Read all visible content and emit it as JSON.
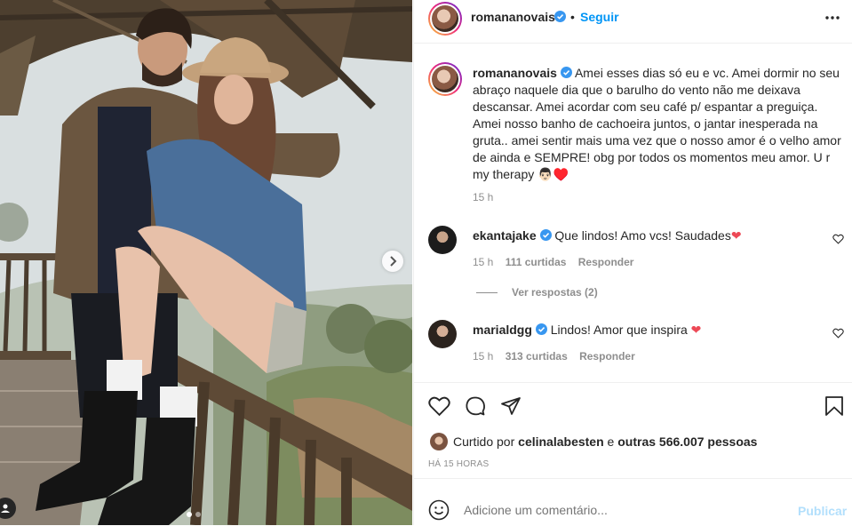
{
  "post": {
    "author": "romananovais",
    "follow_label": "Seguir",
    "separator": "•",
    "caption": "Amei esses dias só eu e vc. Amei dormir no seu abraço naquele dia que o barulho do vento não me deixava descansar. Amei acordar com seu café p/ espantar a preguiça. Amei nosso banho de cachoeira juntos, o jantar inesperada na gruta.. amei sentir mais uma vez que o nosso amor é o velho amor de ainda e SEMPRE! obg por todos os momentos meu amor. U r my therapy 👨🏻♥️",
    "caption_time": "15 h"
  },
  "photo": {
    "carousel_dots": 2,
    "active_dot": 0
  },
  "comments": [
    {
      "username": "ekantajake",
      "text": "Que lindos! Amo vcs! Saudades",
      "emoji": "❤",
      "time": "15 h",
      "likes": "111 curtidas",
      "reply": "Responder",
      "view_replies": "Ver respostas (2)"
    },
    {
      "username": "marialdgg",
      "text": "Lindos! Amor que inspira",
      "emoji": "❤",
      "time": "15 h",
      "likes": "313 curtidas",
      "reply": "Responder"
    }
  ],
  "likes_summary": {
    "prefix": "Curtido por",
    "user": "celinalabesten",
    "middle": "e",
    "others": "outras 566.007 pessoas"
  },
  "timestamp": "HÁ 15 HORAS",
  "add_comment": {
    "placeholder": "Adicione um comentário...",
    "submit": "Publicar"
  },
  "colors": {
    "accent": "#0095f6",
    "verified": "#3897f0",
    "heart": "#ed4956",
    "muted": "#8e8e8e"
  }
}
